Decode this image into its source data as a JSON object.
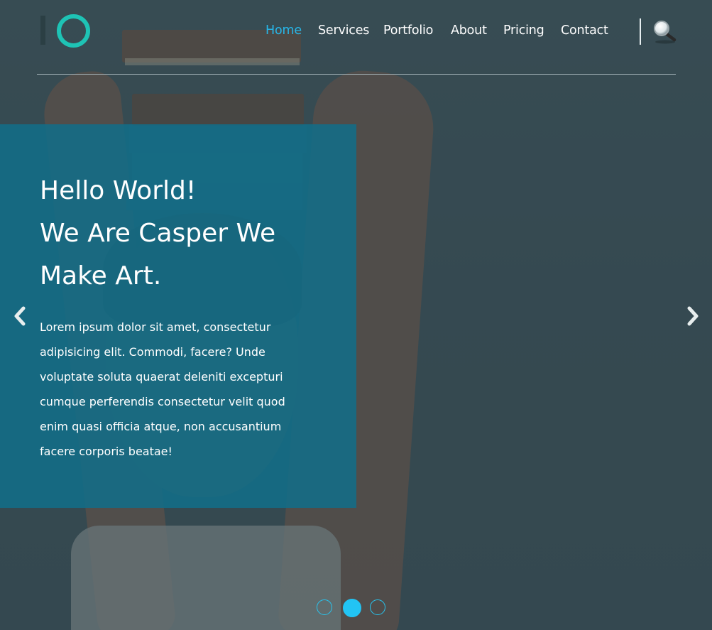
{
  "nav": {
    "items": [
      {
        "label": "Home",
        "active": true
      },
      {
        "label": "Services",
        "active": false
      },
      {
        "label": "Portfolio",
        "active": false
      },
      {
        "label": "About",
        "active": false
      },
      {
        "label": "Pricing",
        "active": false
      },
      {
        "label": "Contact",
        "active": false
      }
    ],
    "search_icon": "magnifier-icon"
  },
  "logo": {
    "icon": "ring-logo-icon",
    "color": "#1ec3b5"
  },
  "slider": {
    "title_lines": [
      "Hello World!",
      "We Are Casper We",
      "Make Art."
    ],
    "text": "Lorem ipsum dolor sit amet, consectetur adipisicing elit. Commodi, facere? Unde voluptate soluta quaerat deleniti excepturi cumque perferendis consectetur velit quod enim quasi officia atque, non accusantium facere corporis beatae!",
    "caption_color": "#106e8a",
    "active_slide": 2,
    "slide_count": 3,
    "prev_icon": "chevron-left-icon",
    "next_icon": "chevron-right-icon"
  },
  "colors": {
    "accent": "#27b6e8",
    "dot_active": "#22c4f4"
  }
}
